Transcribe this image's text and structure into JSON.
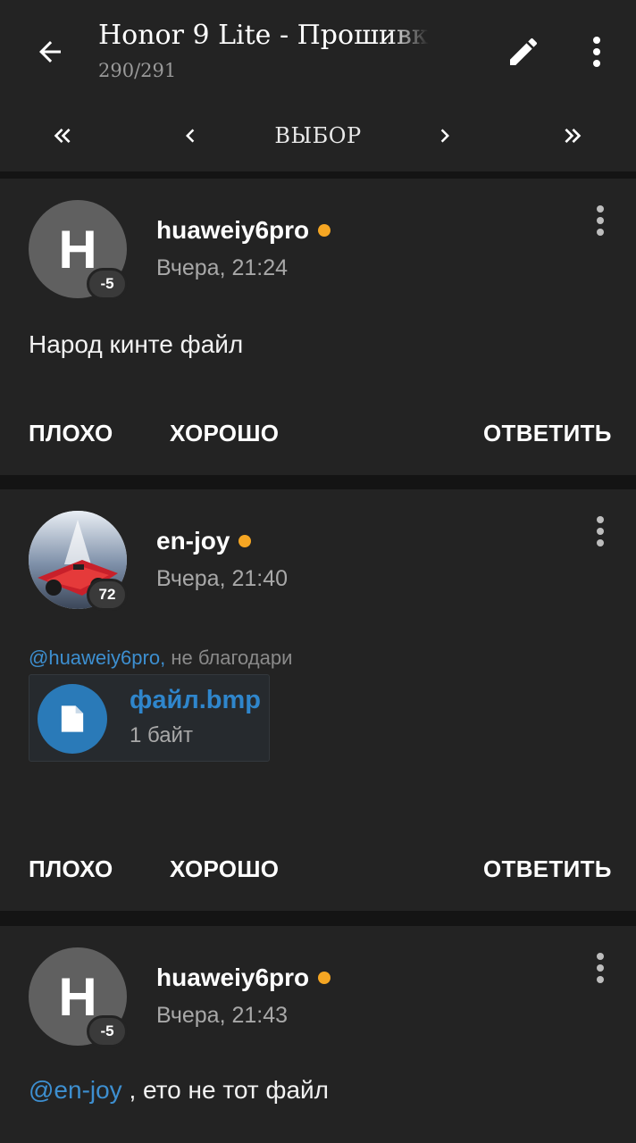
{
  "header": {
    "title": "Honor 9 Lite - Прошивк",
    "subtitle": "290/291",
    "back_icon": "arrow-left-icon",
    "edit_icon": "pencil-icon",
    "more_icon": "more-vert-icon"
  },
  "pager": {
    "first_icon": "double-chevron-left-icon",
    "prev_icon": "chevron-left-icon",
    "select_label": "ВЫБОР",
    "next_icon": "chevron-right-icon",
    "last_icon": "double-chevron-right-icon"
  },
  "posts": [
    {
      "avatar_letter": "H",
      "reputation": "-5",
      "nick": "huaweiy6pro",
      "time": "Вчера, 21:24",
      "text": "Народ кинте файл",
      "actions": [
        "ПЛОХО",
        "ХОРОШО",
        "ОТВЕТИТЬ"
      ]
    },
    {
      "avatar_letter": "",
      "reputation": "72",
      "nick": "en-joy",
      "time": "Вчера, 21:40",
      "quote_mention": "@huaweiy6pro,",
      "quote_text": " не благодари",
      "attachment": {
        "name": "файл.bmp",
        "size": "1 байт",
        "icon": "file-icon"
      },
      "actions": [
        "ПЛОХО",
        "ХОРОШО",
        "ОТВЕТИТЬ"
      ]
    },
    {
      "avatar_letter": "H",
      "reputation": "-5",
      "nick": "huaweiy6pro",
      "time": "Вчера, 21:43",
      "mention": "@en-joy",
      "text": " , ето не тот файл"
    }
  ],
  "colors": {
    "background": "#141414",
    "card": "#232323",
    "accent_blue": "#3d8fd0",
    "online_dot": "#f5a623"
  }
}
